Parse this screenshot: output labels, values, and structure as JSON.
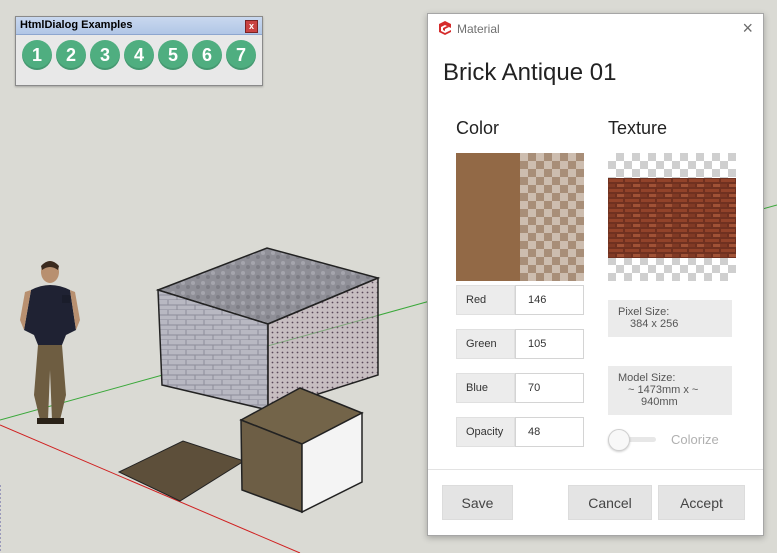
{
  "toolbar": {
    "title": "HtmlDialog Examples",
    "close_glyph": "x",
    "buttons": [
      "1",
      "2",
      "3",
      "4",
      "5",
      "6",
      "7"
    ]
  },
  "dialog": {
    "title": "Material",
    "close_glyph": "×",
    "material_name": "Brick Antique 01",
    "color_heading": "Color",
    "texture_heading": "Texture",
    "color_hex": "#926946",
    "fields": [
      {
        "label": "Red",
        "value": "146"
      },
      {
        "label": "Green",
        "value": "105"
      },
      {
        "label": "Blue",
        "value": "70"
      },
      {
        "label": "Opacity",
        "value": "48"
      }
    ],
    "pixel_size_label": "Pixel Size:",
    "pixel_size_value": "384 x 256",
    "model_size_label": "Model Size:",
    "model_size_line1": "~ 1473mm x ~",
    "model_size_line2": "940mm",
    "colorize_label": "Colorize",
    "colorize_on": false,
    "buttons": {
      "save": "Save",
      "cancel": "Cancel",
      "accept": "Accept"
    }
  },
  "colors": {
    "toolbar_button": "#4fae80",
    "brand_red": "#d52b2b",
    "axis_green": "#3aa83a",
    "axis_red": "#d02020"
  }
}
